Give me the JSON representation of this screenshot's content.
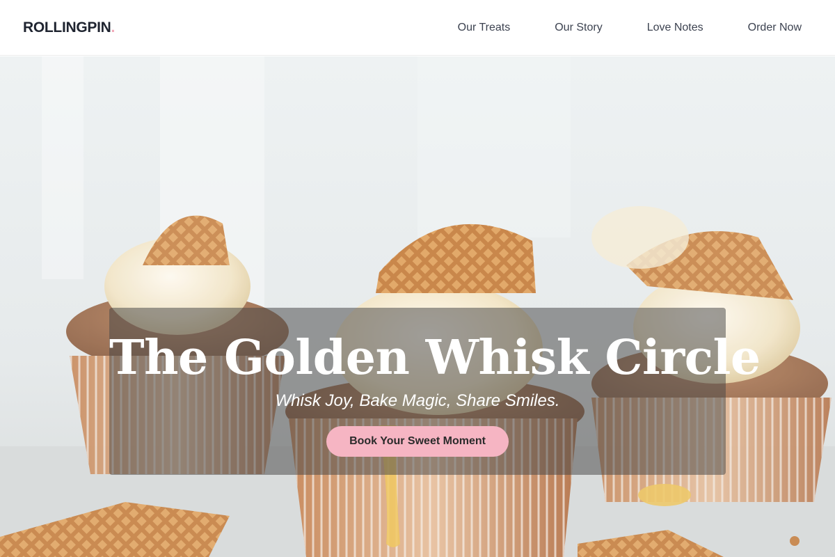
{
  "brand": {
    "name": "ROLLINGPIN",
    "dot": "."
  },
  "nav": {
    "items": [
      {
        "label": "Our Treats"
      },
      {
        "label": "Our Story"
      },
      {
        "label": "Love Notes"
      },
      {
        "label": "Order Now"
      }
    ]
  },
  "hero": {
    "title": "The Golden Whisk Circle",
    "subtitle": "Whisk Joy, Bake Magic, Share Smiles.",
    "cta_label": "Book Your Sweet Moment",
    "image_subject": "cupcakes-with-waffle-cookies"
  },
  "colors": {
    "accent_pink": "#f6b5c3",
    "logo_dot": "#f2a7b7",
    "text_dark": "#1f2430",
    "overlay": "rgba(70,70,70,0.52)"
  }
}
